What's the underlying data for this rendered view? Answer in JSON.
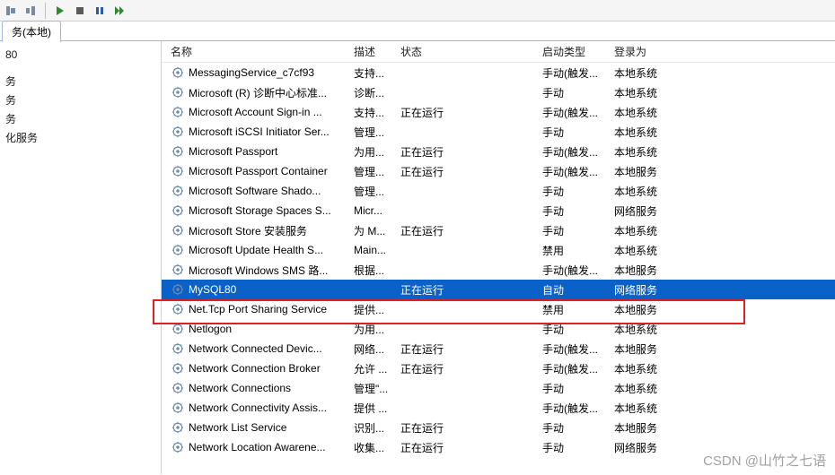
{
  "toolbar": {},
  "tab": {
    "label": "务(本地)"
  },
  "sidebar": {
    "header": "80",
    "items": [
      "务",
      "务",
      "务",
      "化服务"
    ]
  },
  "columns": {
    "name": "名称",
    "desc": "描述",
    "state": "状态",
    "startup": "启动类型",
    "logon": "登录为"
  },
  "rows": [
    {
      "name": "MessagingService_c7cf93",
      "desc": "支持...",
      "state": "",
      "startup": "手动(触发...",
      "logon": "本地系统"
    },
    {
      "name": "Microsoft (R) 诊断中心标准...",
      "desc": "诊断...",
      "state": "",
      "startup": "手动",
      "logon": "本地系统"
    },
    {
      "name": "Microsoft Account Sign-in ...",
      "desc": "支持...",
      "state": "正在运行",
      "startup": "手动(触发...",
      "logon": "本地系统"
    },
    {
      "name": "Microsoft iSCSI Initiator Ser...",
      "desc": "管理...",
      "state": "",
      "startup": "手动",
      "logon": "本地系统"
    },
    {
      "name": "Microsoft Passport",
      "desc": "为用...",
      "state": "正在运行",
      "startup": "手动(触发...",
      "logon": "本地系统"
    },
    {
      "name": "Microsoft Passport Container",
      "desc": "管理...",
      "state": "正在运行",
      "startup": "手动(触发...",
      "logon": "本地服务"
    },
    {
      "name": "Microsoft Software Shado...",
      "desc": "管理...",
      "state": "",
      "startup": "手动",
      "logon": "本地系统"
    },
    {
      "name": "Microsoft Storage Spaces S...",
      "desc": "Micr...",
      "state": "",
      "startup": "手动",
      "logon": "网络服务"
    },
    {
      "name": "Microsoft Store 安装服务",
      "desc": "为 M...",
      "state": "正在运行",
      "startup": "手动",
      "logon": "本地系统"
    },
    {
      "name": "Microsoft Update Health S...",
      "desc": "Main...",
      "state": "",
      "startup": "禁用",
      "logon": "本地系统"
    },
    {
      "name": "Microsoft Windows SMS 路...",
      "desc": "根据...",
      "state": "",
      "startup": "手动(触发...",
      "logon": "本地服务"
    },
    {
      "name": "MySQL80",
      "desc": "",
      "state": "正在运行",
      "startup": "自动",
      "logon": "网络服务",
      "selected": true
    },
    {
      "name": "Net.Tcp Port Sharing Service",
      "desc": "提供...",
      "state": "",
      "startup": "禁用",
      "logon": "本地服务"
    },
    {
      "name": "Netlogon",
      "desc": "为用...",
      "state": "",
      "startup": "手动",
      "logon": "本地系统"
    },
    {
      "name": "Network Connected Devic...",
      "desc": "网络...",
      "state": "正在运行",
      "startup": "手动(触发...",
      "logon": "本地服务"
    },
    {
      "name": "Network Connection Broker",
      "desc": "允许 ...",
      "state": "正在运行",
      "startup": "手动(触发...",
      "logon": "本地系统"
    },
    {
      "name": "Network Connections",
      "desc": "管理\"...",
      "state": "",
      "startup": "手动",
      "logon": "本地系统"
    },
    {
      "name": "Network Connectivity Assis...",
      "desc": "提供 ...",
      "state": "",
      "startup": "手动(触发...",
      "logon": "本地系统"
    },
    {
      "name": "Network List Service",
      "desc": "识别...",
      "state": "正在运行",
      "startup": "手动",
      "logon": "本地服务"
    },
    {
      "name": "Network Location Awarene...",
      "desc": "收集...",
      "state": "正在运行",
      "startup": "手动",
      "logon": "网络服务"
    }
  ],
  "watermark": "CSDN @山竹之七语"
}
